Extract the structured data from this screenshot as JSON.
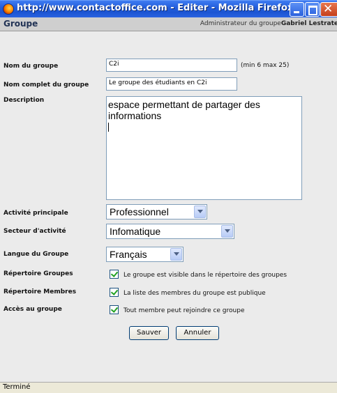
{
  "window": {
    "title": "http://www.contactoffice.com - Editer - Mozilla Firefox",
    "close_glyph": "✕"
  },
  "header": {
    "title": "Groupe",
    "admin_prefix": "Administrateur du groupe",
    "admin_name": "Gabriel Lestrate"
  },
  "form": {
    "group_name": {
      "label": "Nom du groupe",
      "value": "C2i",
      "hint": "(min 6 max 25)"
    },
    "full_name": {
      "label": "Nom complet du groupe",
      "value": "Le groupe des étudiants en C2i"
    },
    "description": {
      "label": "Description",
      "value": "espace permettant de partager des informations"
    },
    "main_activity": {
      "label": "Activité principale",
      "selected": "Professionnel"
    },
    "sector": {
      "label": "Secteur d'activité",
      "selected": "Infomatique"
    },
    "language": {
      "label": "Langue du Groupe",
      "selected": "Français"
    },
    "group_directory": {
      "label": "Répertoire Groupes",
      "checked": true,
      "text": "Le groupe est visible dans le répertoire des groupes"
    },
    "member_directory": {
      "label": "Répertoire Membres",
      "checked": true,
      "text": "La liste des membres du groupe est publique"
    },
    "access": {
      "label": "Accès au groupe",
      "checked": true,
      "text": "Tout membre peut rejoindre ce groupe"
    },
    "save_label": "Sauver",
    "cancel_label": "Annuler"
  },
  "status": {
    "text": "Terminé"
  },
  "colors": {
    "titlebar": "#245edb",
    "content_bg": "#ebebeb",
    "header_band": "#cfcfcf",
    "input_border": "#7f9db9",
    "check_mark": "#21a121"
  }
}
